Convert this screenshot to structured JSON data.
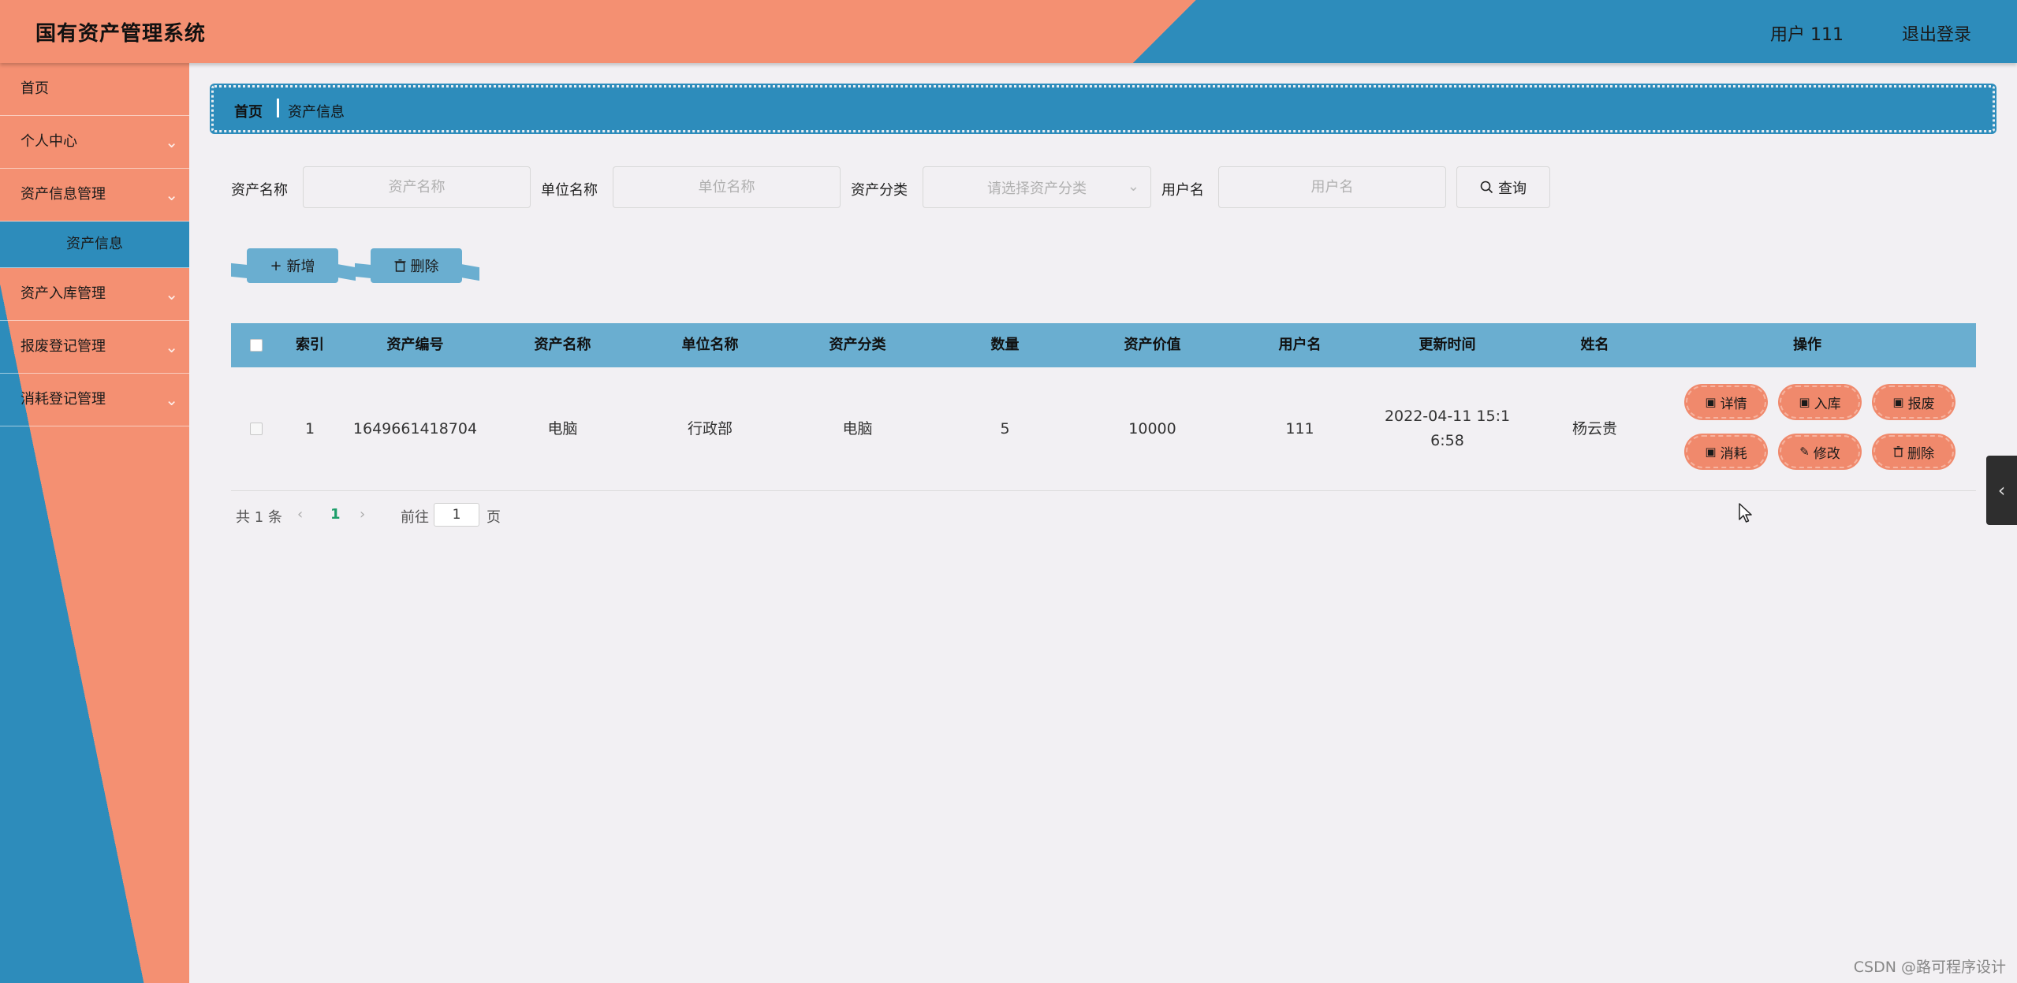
{
  "header": {
    "title": "国有资产管理系统",
    "user": "用户 111",
    "logout": "退出登录"
  },
  "sidebar": {
    "items": [
      {
        "label": "首页"
      },
      {
        "label": "个人中心"
      },
      {
        "label": "资产信息管理"
      },
      {
        "label": "资产信息"
      },
      {
        "label": "资产入库管理"
      },
      {
        "label": "报废登记管理"
      },
      {
        "label": "消耗登记管理"
      }
    ]
  },
  "breadcrumb": {
    "home": "首页",
    "current": "资产信息"
  },
  "search": {
    "asset_name_label": "资产名称",
    "asset_name_placeholder": "资产名称",
    "unit_name_label": "单位名称",
    "unit_name_placeholder": "单位名称",
    "category_label": "资产分类",
    "category_placeholder": "请选择资产分类",
    "username_label": "用户名",
    "username_placeholder": "用户名",
    "query_button": "查询"
  },
  "actions": {
    "add": "新增",
    "delete": "删除"
  },
  "table": {
    "headers": [
      "索引",
      "资产编号",
      "资产名称",
      "单位名称",
      "资产分类",
      "数量",
      "资产价值",
      "用户名",
      "更新时间",
      "姓名",
      "操作"
    ],
    "rows": [
      {
        "index": "1",
        "asset_no": "1649661418704",
        "asset_name": "电脑",
        "unit_name": "行政部",
        "category": "电脑",
        "quantity": "5",
        "value": "10000",
        "username": "111",
        "update_time_line1": "2022-04-11 15:1",
        "update_time_line2": "6:58",
        "name": "杨云贵"
      }
    ],
    "row_buttons": {
      "detail": "详情",
      "stock_in": "入库",
      "scrap": "报废",
      "consume": "消耗",
      "edit": "修改",
      "delete": "删除"
    }
  },
  "pagination": {
    "total": "共 1 条",
    "current_page": "1",
    "goto_label": "前往",
    "goto_value": "1",
    "page_suffix": "页"
  },
  "watermark": "CSDN @路可程序设计",
  "colors": {
    "salmon": "#f49072",
    "blue": "#2d8cbb",
    "light_blue": "#6aaed0",
    "background": "#f2f0f3"
  }
}
